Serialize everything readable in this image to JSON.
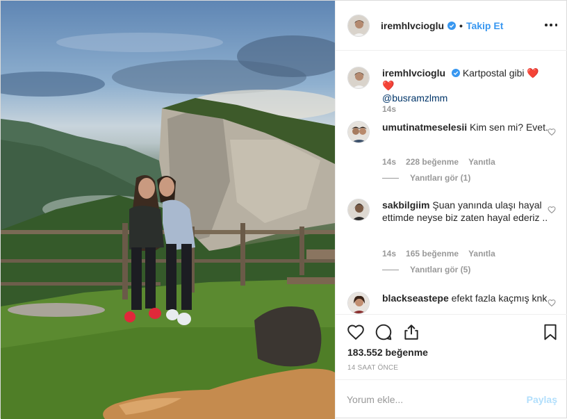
{
  "header": {
    "username": "iremhlvcioglu",
    "separator": "•",
    "follow_label": "Takip Et",
    "more_icon": "more-horizontal-icon"
  },
  "caption": {
    "username": "iremhlvcioglu",
    "text": "Kartpostal gibi",
    "emoji": "❤️❤️",
    "mention": "@busramzlmm",
    "time": "14s"
  },
  "comments": [
    {
      "username": "umutinatmeselesii",
      "text": "Kim sen mi? Evet.",
      "time": "14s",
      "likes": "228 beğenme",
      "reply": "Yanıtla",
      "view_replies": "Yanıtları gör (1)"
    },
    {
      "username": "sakbilgiim",
      "text": "Şuan yanında ulaşı hayal ettimde neyse biz zaten hayal ederiz ..",
      "time": "14s",
      "likes": "165 beğenme",
      "reply": "Yanıtla",
      "view_replies": "Yanıtları gör (5)"
    },
    {
      "username": "blackseastepe",
      "text": "efekt fazla kaçmış knk"
    }
  ],
  "actions": {
    "likes": "183.552 beğenme",
    "time_ago": "14 SAAT ÖNCE"
  },
  "add_comment": {
    "placeholder": "Yorum ekle...",
    "post_label": "Paylaş"
  },
  "colors": {
    "link": "#3897f0",
    "verified": "#3897f0",
    "post_disabled": "#b2dffc",
    "muted": "#999999"
  }
}
